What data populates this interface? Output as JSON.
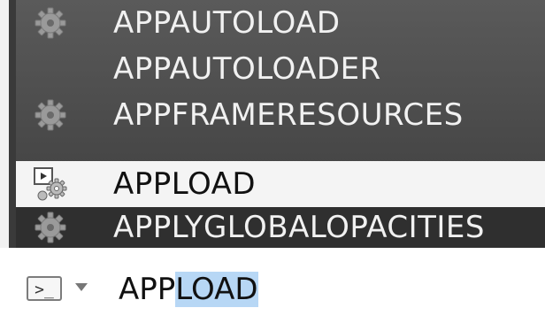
{
  "autocomplete": {
    "items": [
      {
        "label": "APPAUTOLOAD",
        "icon": "gear-icon"
      },
      {
        "label": "APPAUTOLOADER",
        "icon": ""
      },
      {
        "label": "APPFRAMERESOURCES",
        "icon": "gear-icon"
      },
      {
        "label": "APPLOAD",
        "icon": "appload-icon",
        "selected": true
      },
      {
        "label": "APPLYGLOBALOPACITIES",
        "icon": "gear-icon"
      }
    ]
  },
  "command_line": {
    "prompt_icon": "command-prompt-icon",
    "prompt_glyph": ">_",
    "typed_text": "APP",
    "autocompleted_text": "LOAD"
  },
  "colors": {
    "popup_bg": "#4a4a4a",
    "selected_bg": "#f4f4f4",
    "highlight": "#b7d7f5"
  }
}
